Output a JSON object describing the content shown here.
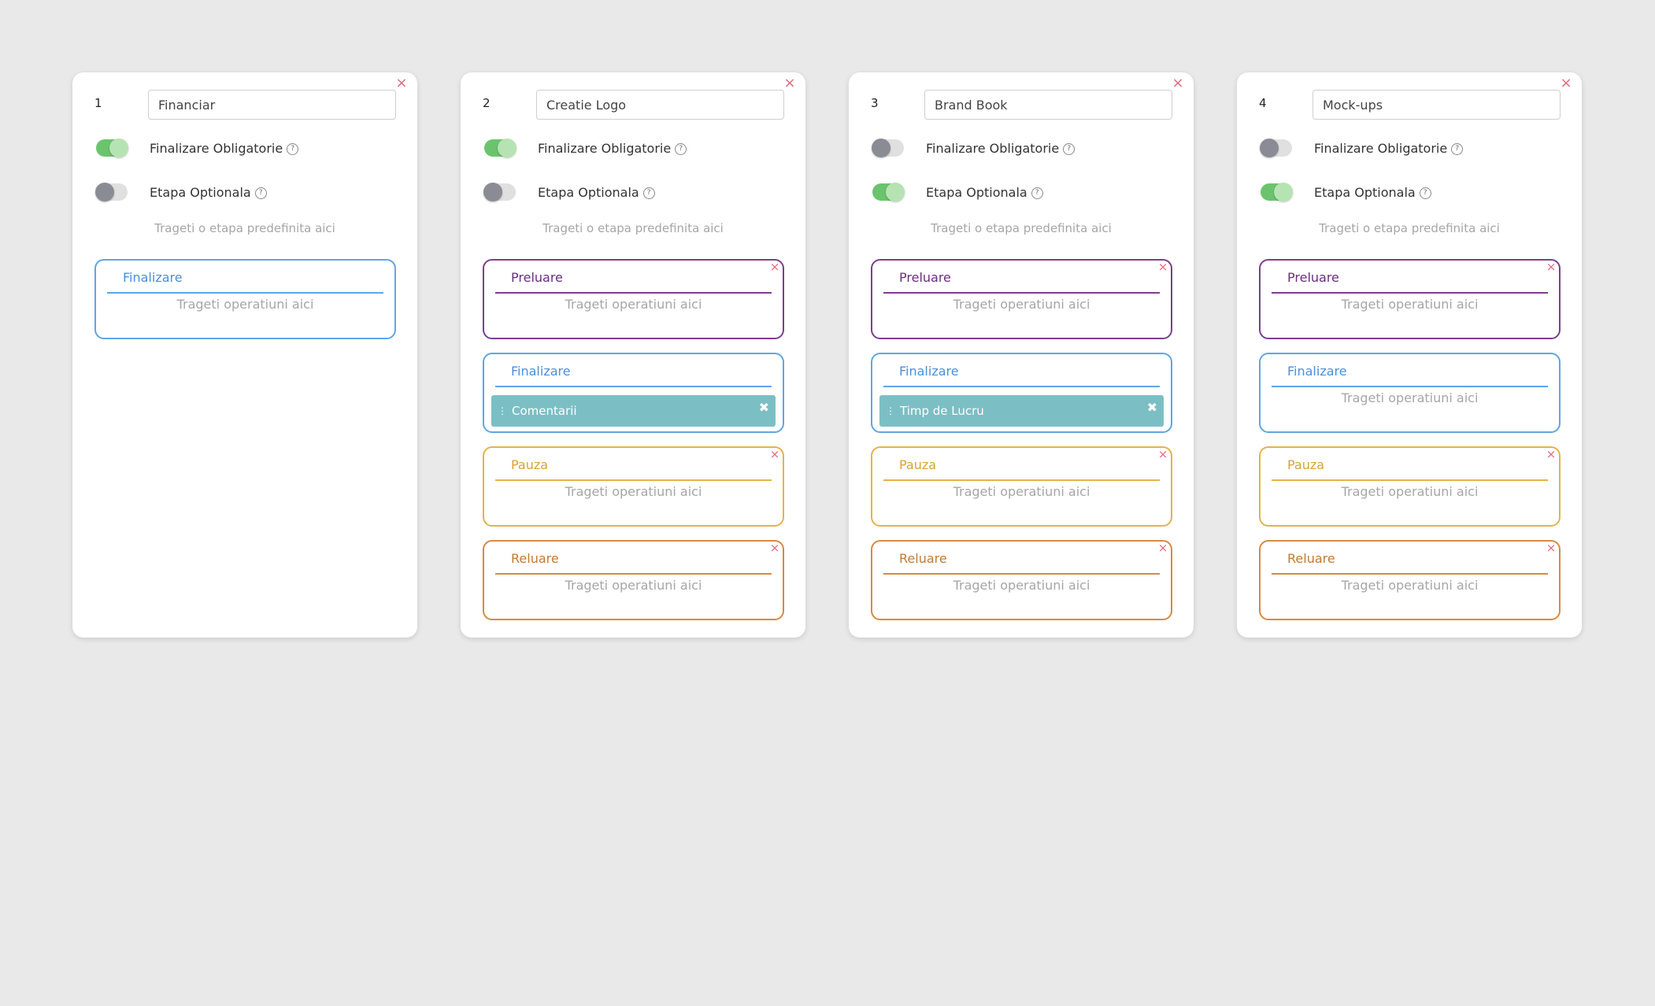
{
  "labels": {
    "mandatory": "Finalizare Obligatorie",
    "optional": "Etapa Optionala",
    "help_glyph": "?",
    "stage_drop_hint": "Trageti o etapa predefinita aici",
    "operation_drop_hint": "Trageti operatiuni aici",
    "close_glyph": "×",
    "op_close_glyph": "✖",
    "drag_handle_glyph": "⋮"
  },
  "colors": {
    "toggle_on": "#6bc46d",
    "toggle_off": "#8b8b95",
    "close_icon": "#e06a7e",
    "operation_bg": "#7bbfc4",
    "stage_preluare": "#7b3f8c",
    "stage_finalizare": "#5fa6e6",
    "stage_pauza": "#e3b44a",
    "stage_reluare": "#d68a45"
  },
  "cards": [
    {
      "number": "1",
      "name": "Financiar",
      "mandatory_on": true,
      "optional_on": false,
      "stages": [
        {
          "title": "Finalizare",
          "color": "blue",
          "closable": false,
          "operation": null
        }
      ]
    },
    {
      "number": "2",
      "name": "Creatie Logo",
      "mandatory_on": true,
      "optional_on": false,
      "stages": [
        {
          "title": "Preluare",
          "color": "purple",
          "closable": true,
          "operation": null
        },
        {
          "title": "Finalizare",
          "color": "blue",
          "closable": false,
          "operation": "Comentarii"
        },
        {
          "title": "Pauza",
          "color": "yellow",
          "closable": true,
          "operation": null
        },
        {
          "title": "Reluare",
          "color": "orange",
          "closable": true,
          "operation": null
        }
      ]
    },
    {
      "number": "3",
      "name": "Brand Book",
      "mandatory_on": false,
      "optional_on": true,
      "stages": [
        {
          "title": "Preluare",
          "color": "purple",
          "closable": true,
          "operation": null
        },
        {
          "title": "Finalizare",
          "color": "blue",
          "closable": false,
          "operation": "Timp de Lucru"
        },
        {
          "title": "Pauza",
          "color": "yellow",
          "closable": true,
          "operation": null
        },
        {
          "title": "Reluare",
          "color": "orange",
          "closable": true,
          "operation": null
        }
      ]
    },
    {
      "number": "4",
      "name": "Mock-ups",
      "mandatory_on": false,
      "optional_on": true,
      "stages": [
        {
          "title": "Preluare",
          "color": "purple",
          "closable": true,
          "operation": null
        },
        {
          "title": "Finalizare",
          "color": "blue",
          "closable": false,
          "operation": null
        },
        {
          "title": "Pauza",
          "color": "yellow",
          "closable": true,
          "operation": null
        },
        {
          "title": "Reluare",
          "color": "orange",
          "closable": true,
          "operation": null
        }
      ]
    }
  ]
}
